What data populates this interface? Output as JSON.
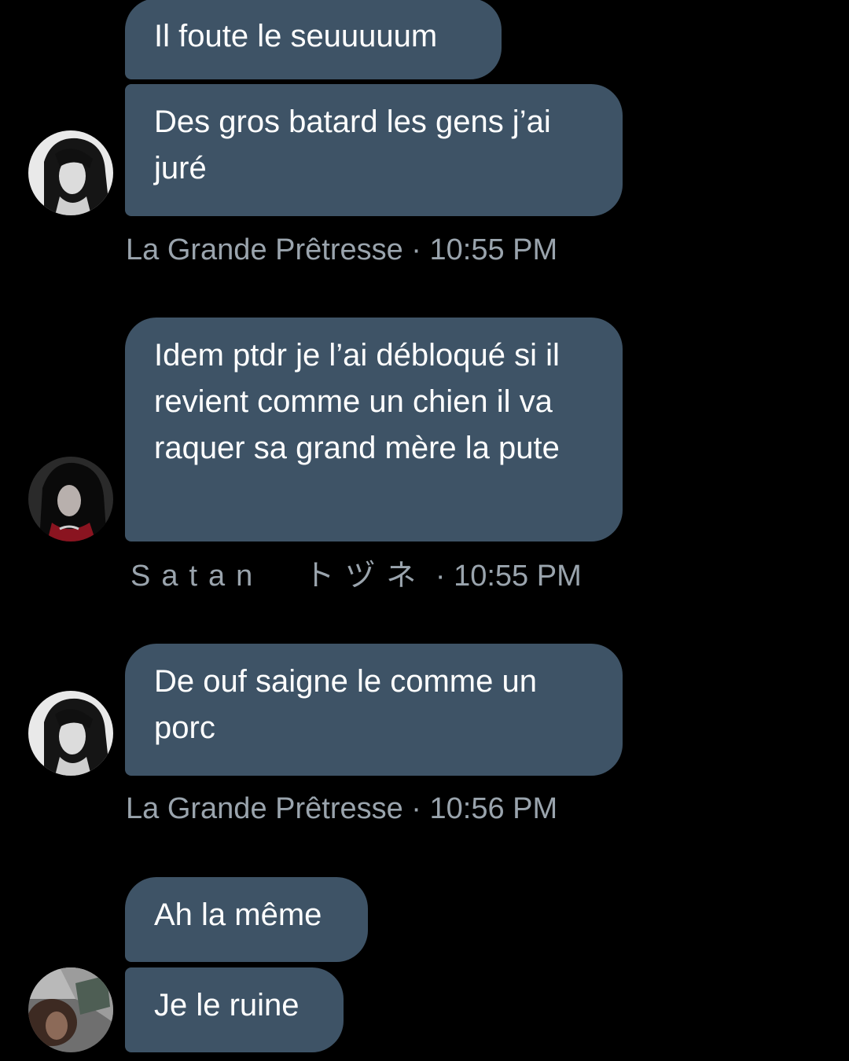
{
  "conversation": {
    "messages": [
      {
        "text": "Il foute le seuuuuum"
      },
      {
        "text": "Des gros batard les gens j’ai juré"
      },
      {
        "text": "Idem ptdr je l’ai débloqué si il revient comme un chien il va raquer sa grand mère la pute"
      },
      {
        "text": "De ouf saigne le comme un porc"
      },
      {
        "text": "Ah la même"
      },
      {
        "text": "Je le ruine"
      }
    ],
    "meta": [
      {
        "sender": "La Grande Prêtresse",
        "separator": " · ",
        "time": "10:55 PM"
      },
      {
        "sender": "Satan　トヅネ",
        "separator": " · ",
        "time": "10:55 PM"
      },
      {
        "sender": "La Grande Prêtresse",
        "separator": " · ",
        "time": "10:56 PM"
      }
    ],
    "avatars": [
      {
        "user": "La Grande Prêtresse",
        "style": "grayscale-portrait"
      },
      {
        "user": "Satan　トヅネ",
        "style": "dark-portrait-red"
      },
      {
        "user": "La Grande Prêtresse",
        "style": "grayscale-portrait"
      },
      {
        "user": "unknown",
        "style": "blurred-photo"
      }
    ]
  },
  "colors": {
    "background": "#000000",
    "bubble": "#3e5366",
    "bubble_text": "#ffffff",
    "meta_text": "#9aa4ad"
  }
}
